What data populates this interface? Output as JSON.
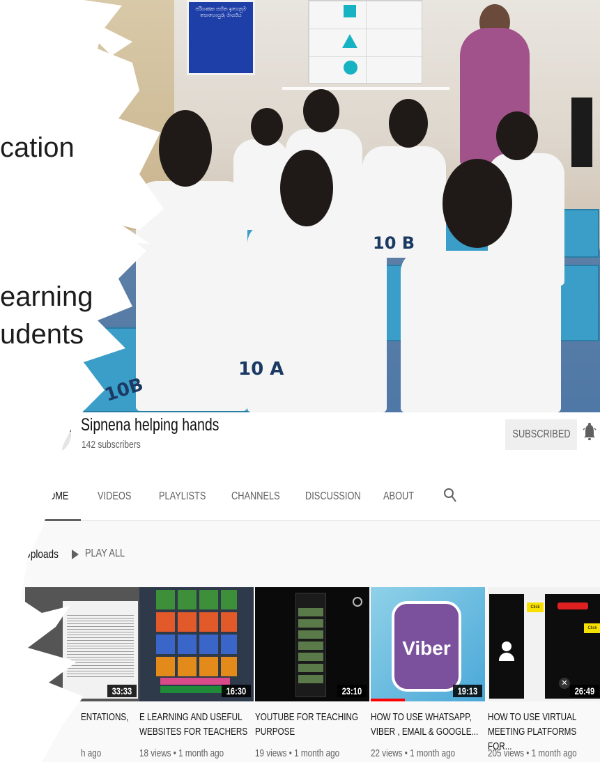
{
  "slide": {
    "line1": "cation",
    "line2": "earning",
    "line3": "udents"
  },
  "photo": {
    "poster_text": "පරිගණක සහිත ඉගෙනුම සොහොයුරු මාර්ගය",
    "chair_labels": [
      "10 B",
      "10 A",
      "10B"
    ]
  },
  "channel": {
    "name": "Sipnena helping hands",
    "subscribers": "142 subscribers",
    "subscribe_label": "SUBSCRIBED",
    "tabs": [
      "HOME",
      "VIDEOS",
      "PLAYLISTS",
      "CHANNELS",
      "DISCUSSION",
      "ABOUT"
    ],
    "active_tab": "HOME"
  },
  "uploads": {
    "label": "Uploads",
    "play_all": "PLAY ALL",
    "videos": [
      {
        "title": "ENTATIONS,",
        "meta": "h ago",
        "duration": "33:33"
      },
      {
        "title": "E LEARNING AND USEFUL WEBSITES FOR TEACHERS",
        "meta": "18 views • 1 month ago",
        "duration": "16:30"
      },
      {
        "title": "YOUTUBE FOR TEACHING PURPOSE",
        "meta": "19 views • 1 month ago",
        "duration": "23:10"
      },
      {
        "title": "HOW TO USE WHATSAPP, VIBER , EMAIL & GOOGLE...",
        "meta": "22 views • 1 month ago",
        "duration": "19:13",
        "thumb_text": "Viber",
        "watched_fraction": 0.3
      },
      {
        "title": "HOW TO USE VIRTUAL MEETING PLATFORMS FOR...",
        "meta": "205 views • 1 month ago",
        "duration": "26:49",
        "thumb_text": "Click here"
      }
    ]
  },
  "colors": {
    "accent_top": "#2e7d6e",
    "viber_purple": "#7b519d",
    "desk_blue": "#3b9ec9"
  }
}
